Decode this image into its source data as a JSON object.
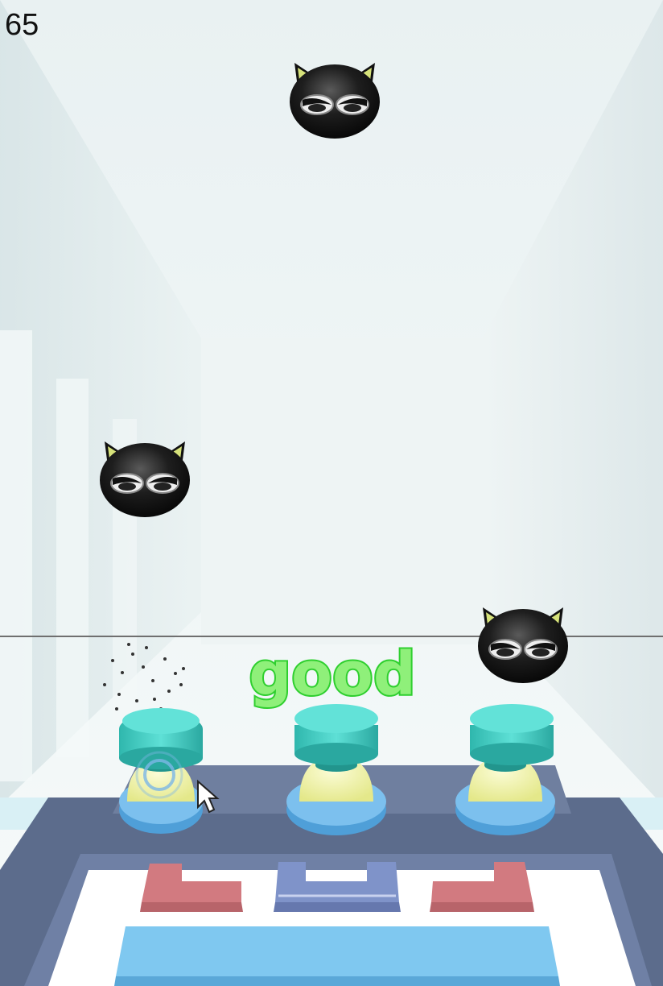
{
  "hud": {
    "score": "65",
    "judgement": "good"
  },
  "colors": {
    "room_wall": "#e4eef0",
    "room_ceiling": "#f2f7f7",
    "hit_line": "#6f6f6f",
    "judgement_fill": "#6fe85a",
    "judgement_outline": "#2fcf2f",
    "button_cap": "#40cfc4",
    "button_dome": "#f2f4a0",
    "button_ring": "#7cc0ee",
    "console_frame": "#5a6a8a",
    "console_panel": "#ffffff",
    "key_left": "#d27a80",
    "key_center": "#7f93c9",
    "key_right": "#d27a80",
    "space_bar": "#7fc8f0"
  },
  "lanes": [
    {
      "name": "left",
      "cat_present": true
    },
    {
      "name": "center",
      "cat_present": true
    },
    {
      "name": "right",
      "cat_present": true
    }
  ],
  "icons": [
    "black-cat-head-icon",
    "mouse-cursor-icon",
    "tap-ripple-icon"
  ]
}
